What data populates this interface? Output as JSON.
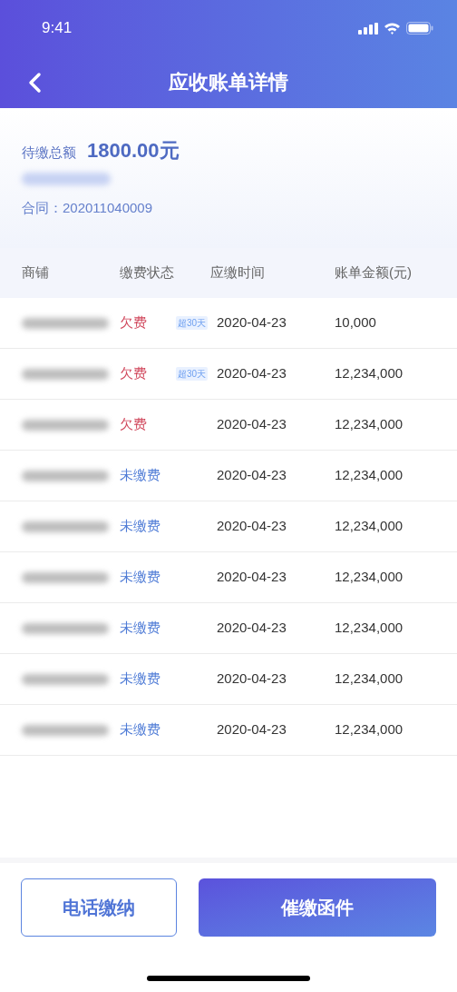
{
  "status_bar": {
    "time": "9:41"
  },
  "nav": {
    "title": "应收账单详情"
  },
  "summary": {
    "total_label": "待缴总额",
    "total_value": "1800.00元",
    "contract": "合同：202011040009"
  },
  "table": {
    "columns": [
      "商铺",
      "缴费状态",
      "应缴时间",
      "账单金额(元)"
    ],
    "rows": [
      {
        "status": "欠费",
        "kind": "overdue",
        "badge": "超30天",
        "date": "2020-04-23",
        "amount": "10,000"
      },
      {
        "status": "欠费",
        "kind": "overdue",
        "badge": "超30天",
        "date": "2020-04-23",
        "amount": "12,234,000"
      },
      {
        "status": "欠费",
        "kind": "overdue",
        "date": "2020-04-23",
        "amount": "12,234,000"
      },
      {
        "status": "未缴费",
        "kind": "unpaid",
        "date": "2020-04-23",
        "amount": "12,234,000"
      },
      {
        "status": "未缴费",
        "kind": "unpaid",
        "date": "2020-04-23",
        "amount": "12,234,000"
      },
      {
        "status": "未缴费",
        "kind": "unpaid",
        "date": "2020-04-23",
        "amount": "12,234,000"
      },
      {
        "status": "未缴费",
        "kind": "unpaid",
        "date": "2020-04-23",
        "amount": "12,234,000"
      },
      {
        "status": "未缴费",
        "kind": "unpaid",
        "date": "2020-04-23",
        "amount": "12,234,000"
      },
      {
        "status": "未缴费",
        "kind": "unpaid",
        "date": "2020-04-23",
        "amount": "12,234,000"
      }
    ]
  },
  "buttons": [
    {
      "label": "电话缴纳",
      "kind": "outline"
    },
    {
      "label": "催缴函件",
      "kind": "primary"
    }
  ]
}
